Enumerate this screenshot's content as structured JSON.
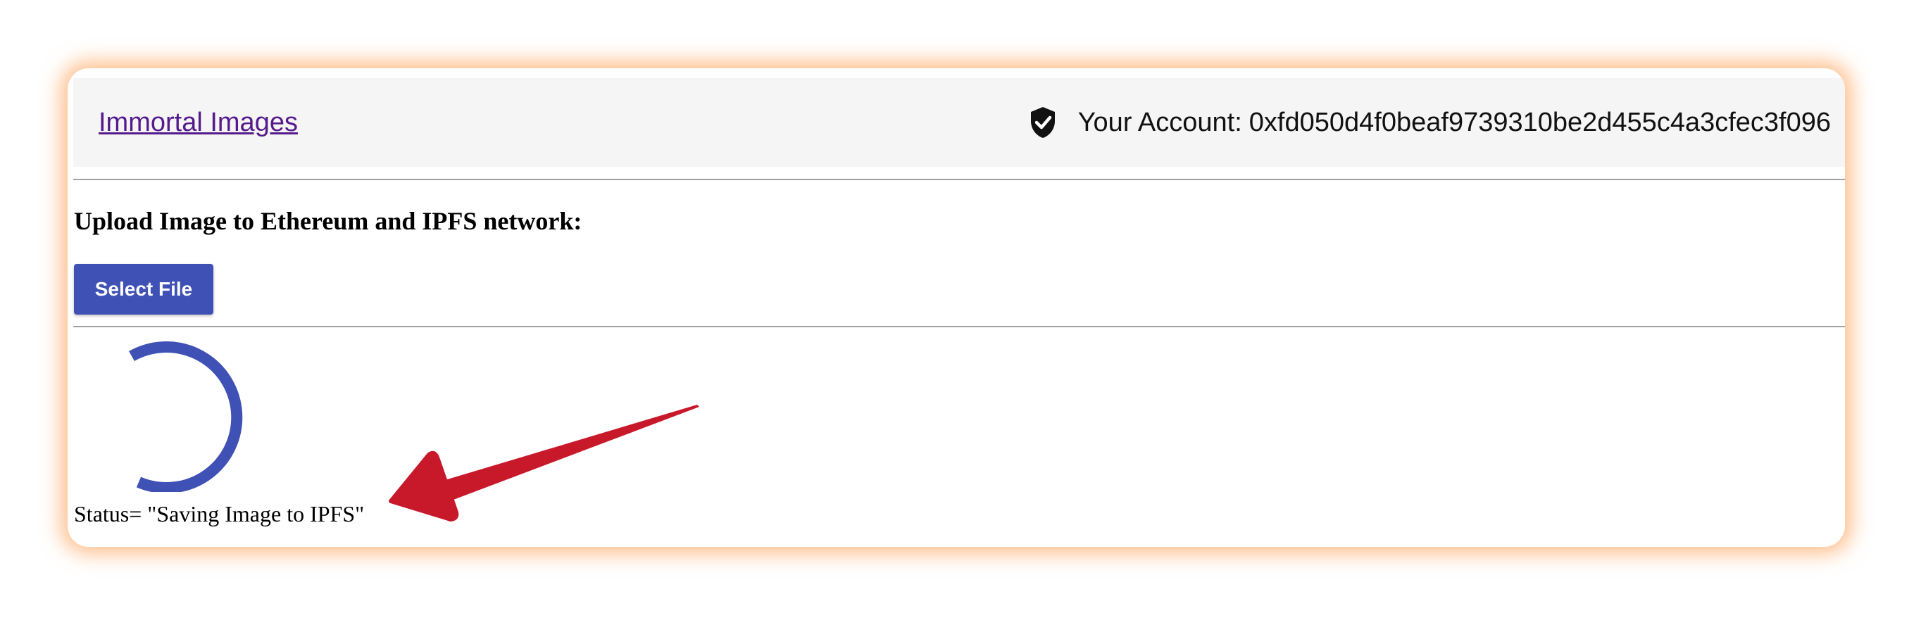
{
  "navbar": {
    "brand": "Immortal Images",
    "account_label": "Your Account:",
    "account_address": "0xfd050d4f0beaf9739310be2d455c4a3cfec3f096",
    "shield_icon": "shield-check-icon"
  },
  "main": {
    "heading": "Upload Image to Ethereum and IPFS network:",
    "select_file_label": "Select File",
    "status_text": "Status= \"Saving Image to IPFS\""
  },
  "colors": {
    "accent": "#3f51b5",
    "link": "#551a8b",
    "annotation_arrow": "#c8192a",
    "window_glow": "#ff8c32"
  }
}
